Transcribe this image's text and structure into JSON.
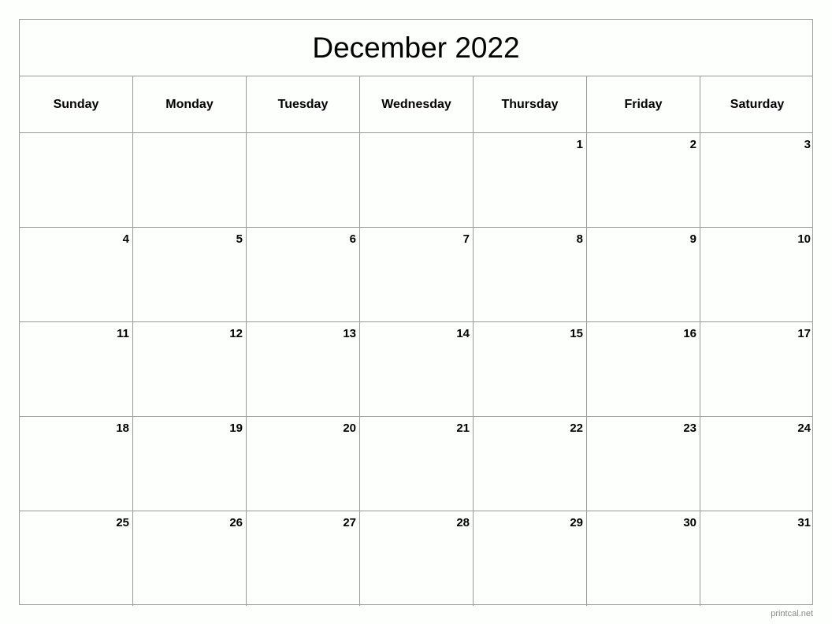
{
  "calendar": {
    "title": "December 2022",
    "weekdays": [
      "Sunday",
      "Monday",
      "Tuesday",
      "Wednesday",
      "Thursday",
      "Friday",
      "Saturday"
    ],
    "weeks": [
      [
        "",
        "",
        "",
        "",
        "1",
        "2",
        "3"
      ],
      [
        "4",
        "5",
        "6",
        "7",
        "8",
        "9",
        "10"
      ],
      [
        "11",
        "12",
        "13",
        "14",
        "15",
        "16",
        "17"
      ],
      [
        "18",
        "19",
        "20",
        "21",
        "22",
        "23",
        "24"
      ],
      [
        "25",
        "26",
        "27",
        "28",
        "29",
        "30",
        "31"
      ]
    ]
  },
  "footer": {
    "credit": "printcal.net"
  }
}
